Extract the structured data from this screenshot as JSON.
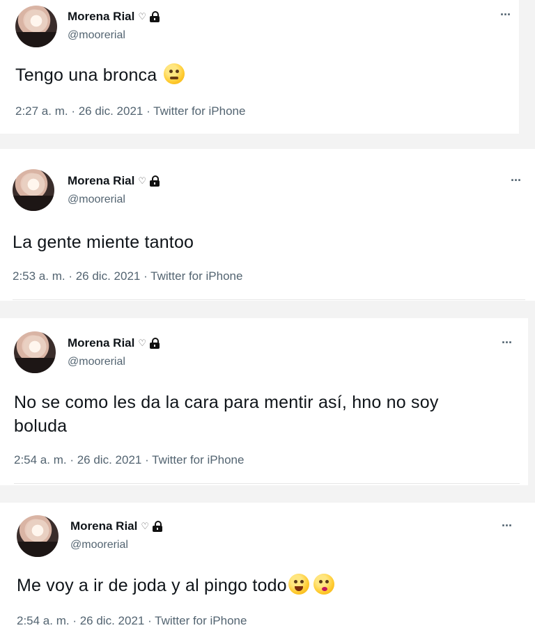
{
  "tweets": [
    {
      "name": "Morena Rial",
      "heart": "♡",
      "handle": "@moorerial",
      "text": "Tengo una bronca",
      "emojis": [
        "face-with-rolling-eyes"
      ],
      "time": "2:27 a. m.",
      "date": "26 dic. 2021",
      "source": "Twitter for iPhone",
      "more": "···"
    },
    {
      "name": "Morena Rial",
      "heart": "♡",
      "handle": "@moorerial",
      "text": "La gente miente tantoo",
      "emojis": [],
      "time": "2:53 a. m.",
      "date": "26 dic. 2021",
      "source": "Twitter for iPhone",
      "more": "···"
    },
    {
      "name": "Morena Rial",
      "heart": "♡",
      "handle": "@moorerial",
      "text_line1": "No se como les da la cara para mentir así, hno no soy",
      "text_line2": "boluda",
      "emojis": [],
      "time": "2:54 a. m.",
      "date": "26 dic. 2021",
      "source": "Twitter for iPhone",
      "more": "···"
    },
    {
      "name": "Morena Rial",
      "heart": "♡",
      "handle": "@moorerial",
      "text": "Me voy a ir de joda y al pingo todo",
      "emojis": [
        "zany-face",
        "face-blowing-a-kiss"
      ],
      "time": "2:54 a. m.",
      "date": "26 dic. 2021",
      "source": "Twitter for iPhone",
      "more": "···"
    }
  ],
  "separator": " · "
}
